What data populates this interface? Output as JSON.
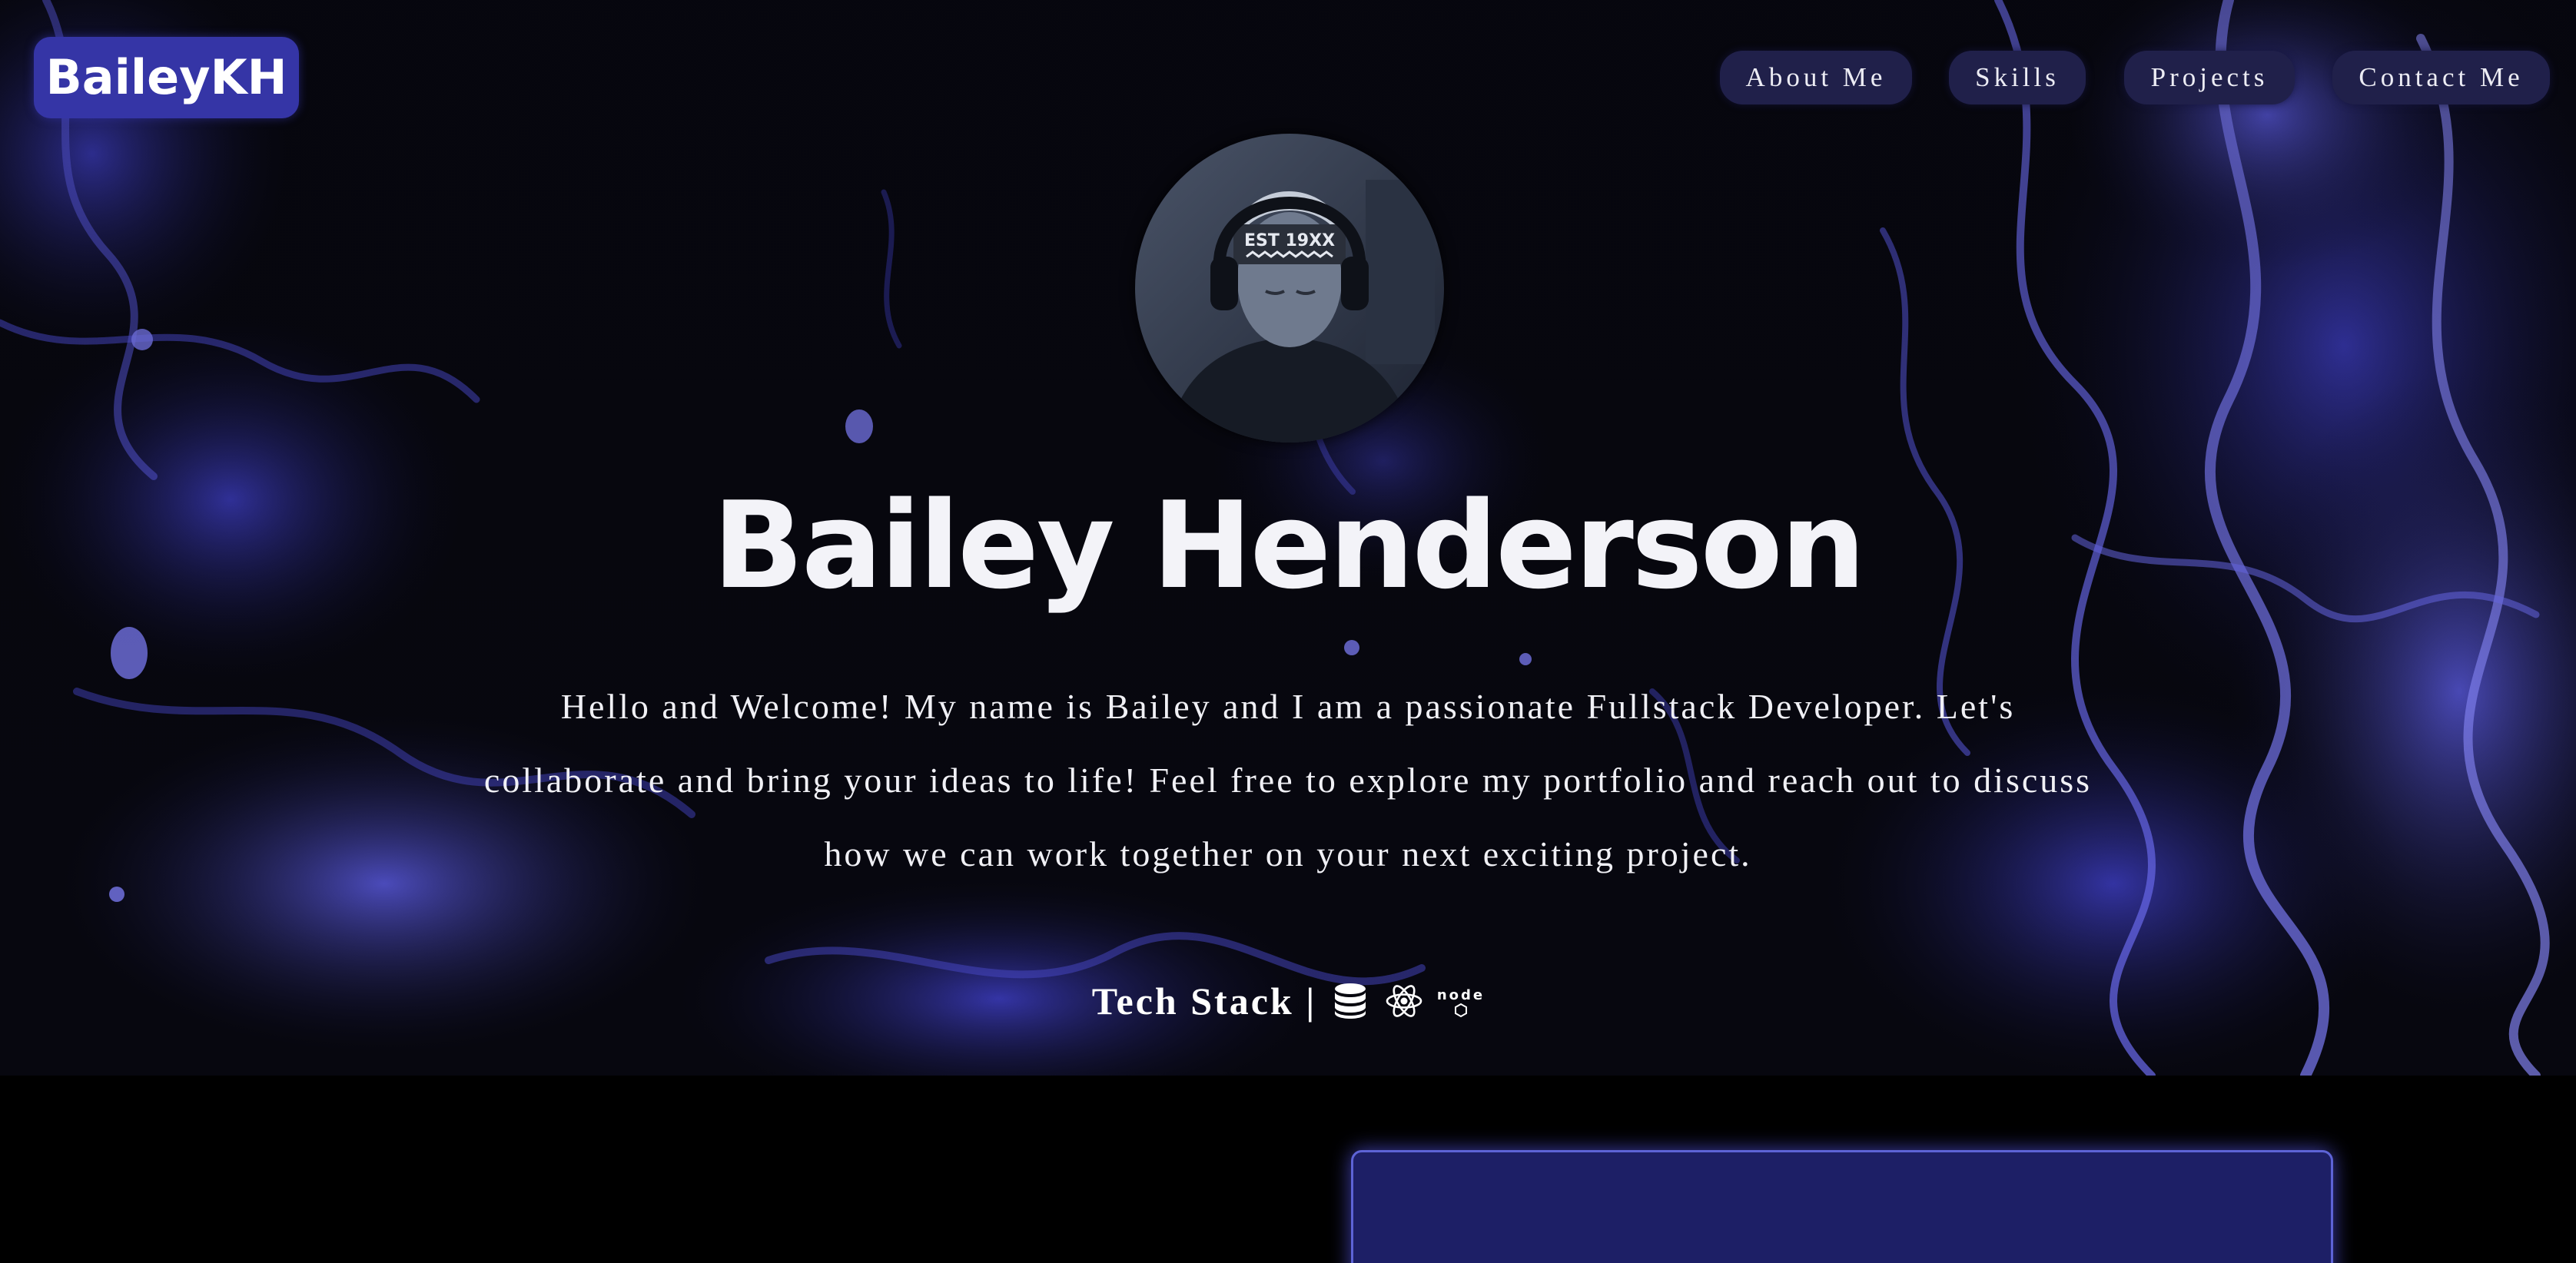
{
  "brand": {
    "logo_text": "BaileyKH"
  },
  "nav": {
    "items": [
      {
        "label": "About Me"
      },
      {
        "label": "Skills"
      },
      {
        "label": "Projects"
      },
      {
        "label": "Contact Me"
      }
    ]
  },
  "hero": {
    "name": "Bailey Henderson",
    "intro_lines": [
      "Hello and Welcome! My name is Bailey and I am a passionate Fullstack Developer. Let's",
      "collaborate and bring your ideas to life! Feel free to explore my portfolio and reach out to discuss",
      "how we can work together on your next exciting project."
    ],
    "avatar": {
      "headband_text": "EST 19XX"
    },
    "tech_stack": {
      "label": "Tech Stack |",
      "icons": [
        "database-icon",
        "react-icon",
        "nodejs-icon"
      ],
      "node_text": "node"
    }
  },
  "colors": {
    "accent": "#3535a6",
    "nav_bg": "#20204a",
    "card_bg": "#1d1f66",
    "card_border": "#5d63d6",
    "background": "#000000"
  }
}
